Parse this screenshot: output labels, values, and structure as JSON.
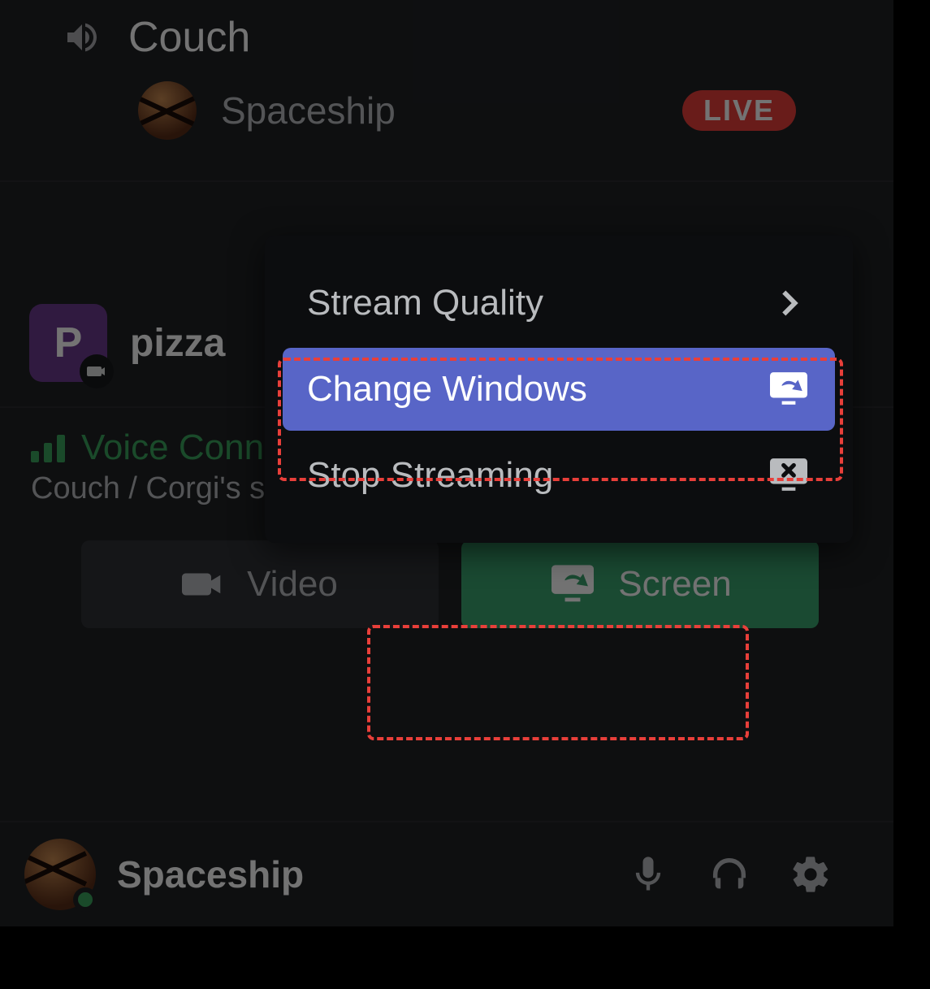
{
  "channel": {
    "name": "Couch"
  },
  "participant": {
    "name": "Spaceship",
    "live_badge": "LIVE"
  },
  "activity": {
    "icon_letter": "P",
    "name": "pizza"
  },
  "voice": {
    "status_label": "Voice Connected",
    "location": "Couch / Corgi's server"
  },
  "buttons": {
    "video": "Video",
    "screen": "Screen"
  },
  "user": {
    "name": "Spaceship"
  },
  "menu": {
    "stream_quality": "Stream Quality",
    "change_windows": "Change Windows",
    "stop_streaming": "Stop Streaming"
  }
}
